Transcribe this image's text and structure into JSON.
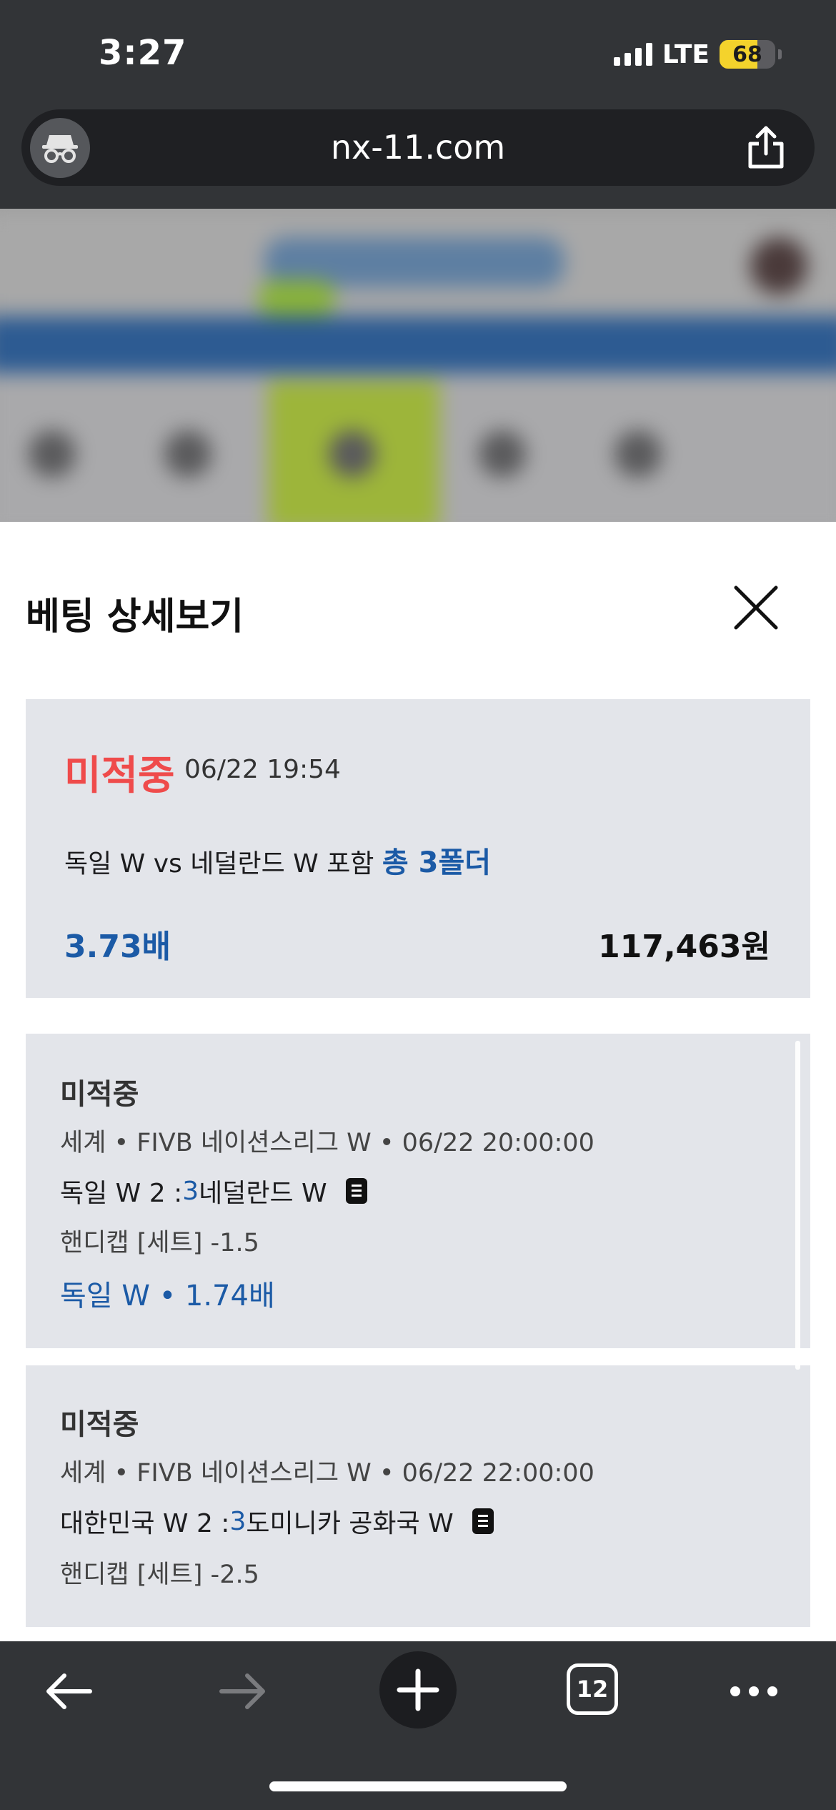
{
  "status_bar": {
    "time": "3:27",
    "network": "LTE",
    "battery_level": "68",
    "battery_fraction": 0.68,
    "signal_bars": 4
  },
  "browser": {
    "url": "nx-11.com",
    "incognito_icon": "incognito-icon",
    "share_icon": "share-icon",
    "tab_count": "12",
    "toolbar_icons": [
      "back-arrow-icon",
      "forward-arrow-icon",
      "plus-icon",
      "tabs-icon",
      "more-icon"
    ]
  },
  "modal": {
    "title": "베팅 상세보기",
    "close_icon": "close-icon",
    "summary": {
      "status": "미적중",
      "datetime": "06/22 19:54",
      "description": "독일 W vs 네덜란드 W 포함",
      "folder_count": "총 3폴더",
      "odds": "3.73배",
      "amount": "117,463원"
    },
    "bets": [
      {
        "status": "미적중",
        "league": "세계  •  FIVB 네이션스리그 W  •  06/22 20:00:00",
        "home": "독일 W 2 : ",
        "away_score": "3",
        "away": " 네덜란드 W",
        "handicap": "핸디캡 [세트] -1.5",
        "pick": "독일 W  •  1.74배"
      },
      {
        "status": "미적중",
        "league": "세계  •  FIVB 네이션스리그 W  •  06/22 22:00:00",
        "home": "대한민국 W 2 : ",
        "away_score": "3",
        "away": " 도미니카 공화국 W",
        "handicap": "핸디캡 [세트] -2.5",
        "pick": ""
      }
    ]
  },
  "colors": {
    "chrome": "#323437",
    "card_bg": "#e3e5ea",
    "miss_red": "#ef4b4b",
    "accent_blue": "#1b5aa6"
  }
}
